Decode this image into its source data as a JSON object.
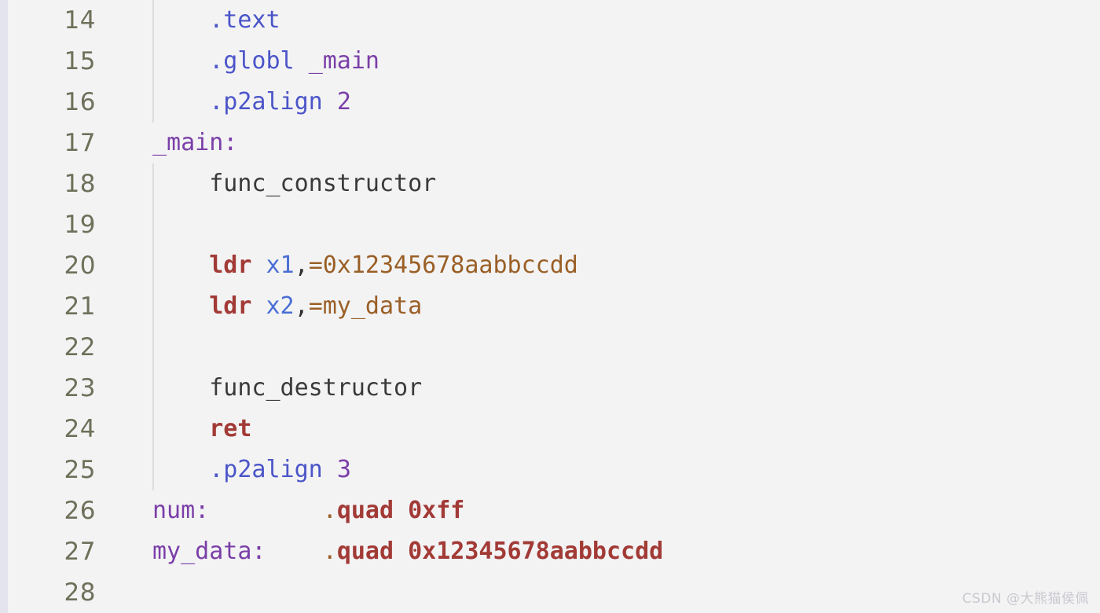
{
  "editor": {
    "background_color": "#f3f3f4",
    "gutter_color": "#6f705a",
    "left_strip_color": "#e3e4ee",
    "indent_guide_color": "#dcdcdc",
    "first_line_number": 14,
    "last_line_number": 28,
    "line_height_px": 52,
    "language": "arm64-assembly"
  },
  "palette": {
    "directive": "#4b55c8",
    "identifier": "#7b3fa8",
    "instruction": "#a23a36",
    "register": "#4a6fd4",
    "operand": "#9a5f26",
    "plain": "#3a3a3a",
    "number": "#7b3fa8",
    "data_directive": "#a23a36"
  },
  "lines": [
    {
      "number": "14",
      "indent_guide": true,
      "tokens": [
        {
          "text": "    ",
          "cls": "t-plain"
        },
        {
          "text": ".text",
          "cls": "t-directive"
        }
      ]
    },
    {
      "number": "15",
      "indent_guide": true,
      "tokens": [
        {
          "text": "    ",
          "cls": "t-plain"
        },
        {
          "text": ".globl ",
          "cls": "t-directive"
        },
        {
          "text": "_main",
          "cls": "t-ident"
        }
      ]
    },
    {
      "number": "16",
      "indent_guide": true,
      "tokens": [
        {
          "text": "    ",
          "cls": "t-plain"
        },
        {
          "text": ".p2align ",
          "cls": "t-directive"
        },
        {
          "text": "2",
          "cls": "t-num"
        }
      ]
    },
    {
      "number": "17",
      "indent_guide": false,
      "tokens": [
        {
          "text": "_main:",
          "cls": "t-ident"
        }
      ]
    },
    {
      "number": "18",
      "indent_guide": true,
      "tokens": [
        {
          "text": "    ",
          "cls": "t-plain"
        },
        {
          "text": "func_constructor",
          "cls": "t-plain"
        }
      ]
    },
    {
      "number": "19",
      "indent_guide": true,
      "tokens": []
    },
    {
      "number": "20",
      "indent_guide": true,
      "tokens": [
        {
          "text": "    ",
          "cls": "t-plain"
        },
        {
          "text": "ldr",
          "cls": "t-instr"
        },
        {
          "text": " ",
          "cls": "t-plain"
        },
        {
          "text": "x1",
          "cls": "t-reg"
        },
        {
          "text": ",",
          "cls": "t-punct"
        },
        {
          "text": "=0x12345678aabbccdd",
          "cls": "t-operand"
        }
      ]
    },
    {
      "number": "21",
      "indent_guide": true,
      "tokens": [
        {
          "text": "    ",
          "cls": "t-plain"
        },
        {
          "text": "ldr",
          "cls": "t-instr"
        },
        {
          "text": " ",
          "cls": "t-plain"
        },
        {
          "text": "x2",
          "cls": "t-reg"
        },
        {
          "text": ",",
          "cls": "t-punct"
        },
        {
          "text": "=my_data",
          "cls": "t-operand"
        }
      ]
    },
    {
      "number": "22",
      "indent_guide": true,
      "tokens": []
    },
    {
      "number": "23",
      "indent_guide": true,
      "tokens": [
        {
          "text": "    ",
          "cls": "t-plain"
        },
        {
          "text": "func_destructor",
          "cls": "t-plain"
        }
      ]
    },
    {
      "number": "24",
      "indent_guide": true,
      "tokens": [
        {
          "text": "    ",
          "cls": "t-plain"
        },
        {
          "text": "ret",
          "cls": "t-instr"
        }
      ]
    },
    {
      "number": "25",
      "indent_guide": true,
      "tokens": [
        {
          "text": "    ",
          "cls": "t-plain"
        },
        {
          "text": ".p2align ",
          "cls": "t-directive"
        },
        {
          "text": "3",
          "cls": "t-num"
        }
      ]
    },
    {
      "number": "26",
      "indent_guide": false,
      "tokens": [
        {
          "text": "num:",
          "cls": "t-ident"
        },
        {
          "text": "        ",
          "cls": "t-plain"
        },
        {
          "text": ".",
          "cls": "t-dot"
        },
        {
          "text": "quad 0xff",
          "cls": "t-data"
        }
      ]
    },
    {
      "number": "27",
      "indent_guide": false,
      "tokens": [
        {
          "text": "my_data:",
          "cls": "t-ident"
        },
        {
          "text": "    ",
          "cls": "t-plain"
        },
        {
          "text": ".",
          "cls": "t-dot"
        },
        {
          "text": "quad 0x12345678aabbccdd",
          "cls": "t-data"
        }
      ]
    },
    {
      "number": "28",
      "indent_guide": false,
      "tokens": []
    }
  ],
  "watermark": {
    "text": "CSDN @大熊猫侯佩"
  }
}
